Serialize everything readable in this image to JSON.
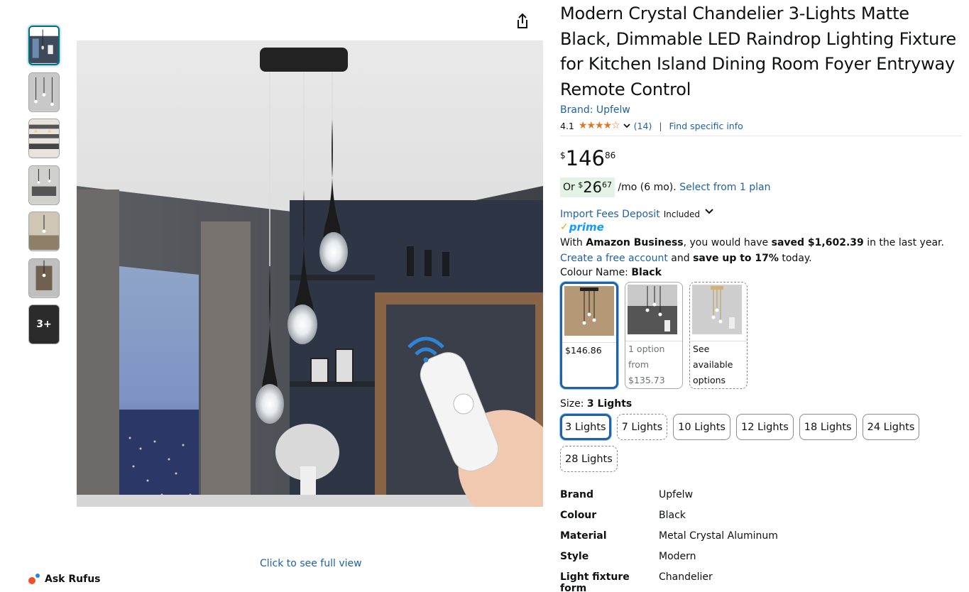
{
  "gallery": {
    "more_label": "3+",
    "full_view_label": "Click to see full view"
  },
  "rufus": {
    "label": "Ask Rufus"
  },
  "product": {
    "title": "Modern Crystal Chandelier 3-Lights Matte Black, Dimmable LED Raindrop Lighting Fixture for Kitchen Island Dining Room Foyer Entryway Remote Control",
    "brand_link": "Brand: Upfelw",
    "rating_value": "4.1",
    "rating_stars": 4.1,
    "rating_count": "(14)",
    "find_info": "Find specific info",
    "price": {
      "symbol": "$",
      "whole": "146",
      "fraction": "86"
    },
    "emi": {
      "prefix": "Or ",
      "symbol": "$",
      "whole": "26",
      "fraction": "67",
      "suffix": " /mo (6 mo). ",
      "plan_link": "Select from 1 plan"
    },
    "import_fees": {
      "label": "Import Fees Deposit",
      "status": "Included"
    },
    "prime_label": "prime",
    "business": {
      "text1": "With ",
      "bold1": "Amazon Business",
      "text2": ", you would have ",
      "bold2": "saved $1,602.39",
      "text3": " in the last year. ",
      "link": "Create a free account",
      "text4": " and ",
      "bold3": "save up to 17%",
      "text5": " today."
    },
    "colour": {
      "label": "Colour Name: ",
      "value": "Black",
      "options": [
        {
          "text": "$146.86"
        },
        {
          "text1": "1 option",
          "text2": "from",
          "text3": "$135.73"
        },
        {
          "text1": "See",
          "text2": "available",
          "text3": "options"
        }
      ]
    },
    "size": {
      "label": "Size: ",
      "value": "3 Lights",
      "options": [
        "3 Lights",
        "7 Lights",
        "10 Lights",
        "12 Lights",
        "18 Lights",
        "24 Lights",
        "28 Lights"
      ]
    },
    "specs": [
      {
        "key": "Brand",
        "value": "Upfelw"
      },
      {
        "key": "Colour",
        "value": "Black"
      },
      {
        "key": "Material",
        "value": "Metal Crystal Aluminum"
      },
      {
        "key": "Style",
        "value": "Modern"
      },
      {
        "key": "Light fixture form",
        "value": "Chandelier"
      }
    ]
  },
  "colors": {
    "link": "#2162a1",
    "star": "#de7921",
    "prime": "#1399ff",
    "selected_border": "#2162a1",
    "emi_bg": "#e3f4e6"
  }
}
